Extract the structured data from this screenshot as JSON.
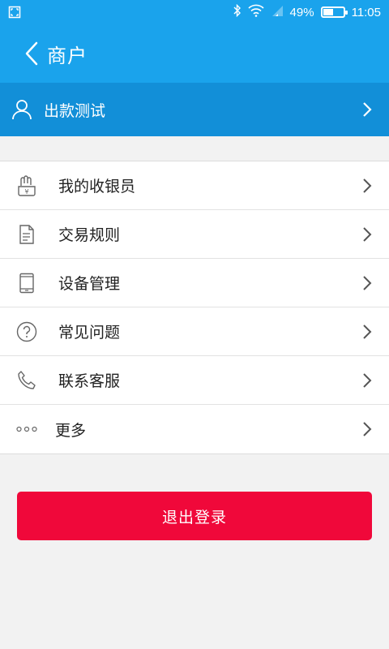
{
  "status_bar": {
    "battery": "49%",
    "battery_level": 0.49,
    "time": "11:05",
    "icons": [
      "screenshot-icon",
      "bluetooth-icon",
      "wifi-icon",
      "signal-icon",
      "battery-icon"
    ]
  },
  "header": {
    "title": "商户"
  },
  "account": {
    "name": "出款测试"
  },
  "menu": {
    "items": [
      {
        "label": "我的收银员",
        "icon": "cashier-icon"
      },
      {
        "label": "交易规则",
        "icon": "document-icon"
      },
      {
        "label": "设备管理",
        "icon": "tablet-icon"
      },
      {
        "label": "常见问题",
        "icon": "question-icon"
      },
      {
        "label": "联系客服",
        "icon": "phone-icon"
      },
      {
        "label": "更多",
        "icon": "more-dots-icon"
      }
    ]
  },
  "logout": {
    "label": "退出登录"
  },
  "colors": {
    "header_bg": "#1aa3ec",
    "account_bg": "#128fd8",
    "logout_bg": "#f0083a",
    "page_bg": "#f2f2f2"
  }
}
